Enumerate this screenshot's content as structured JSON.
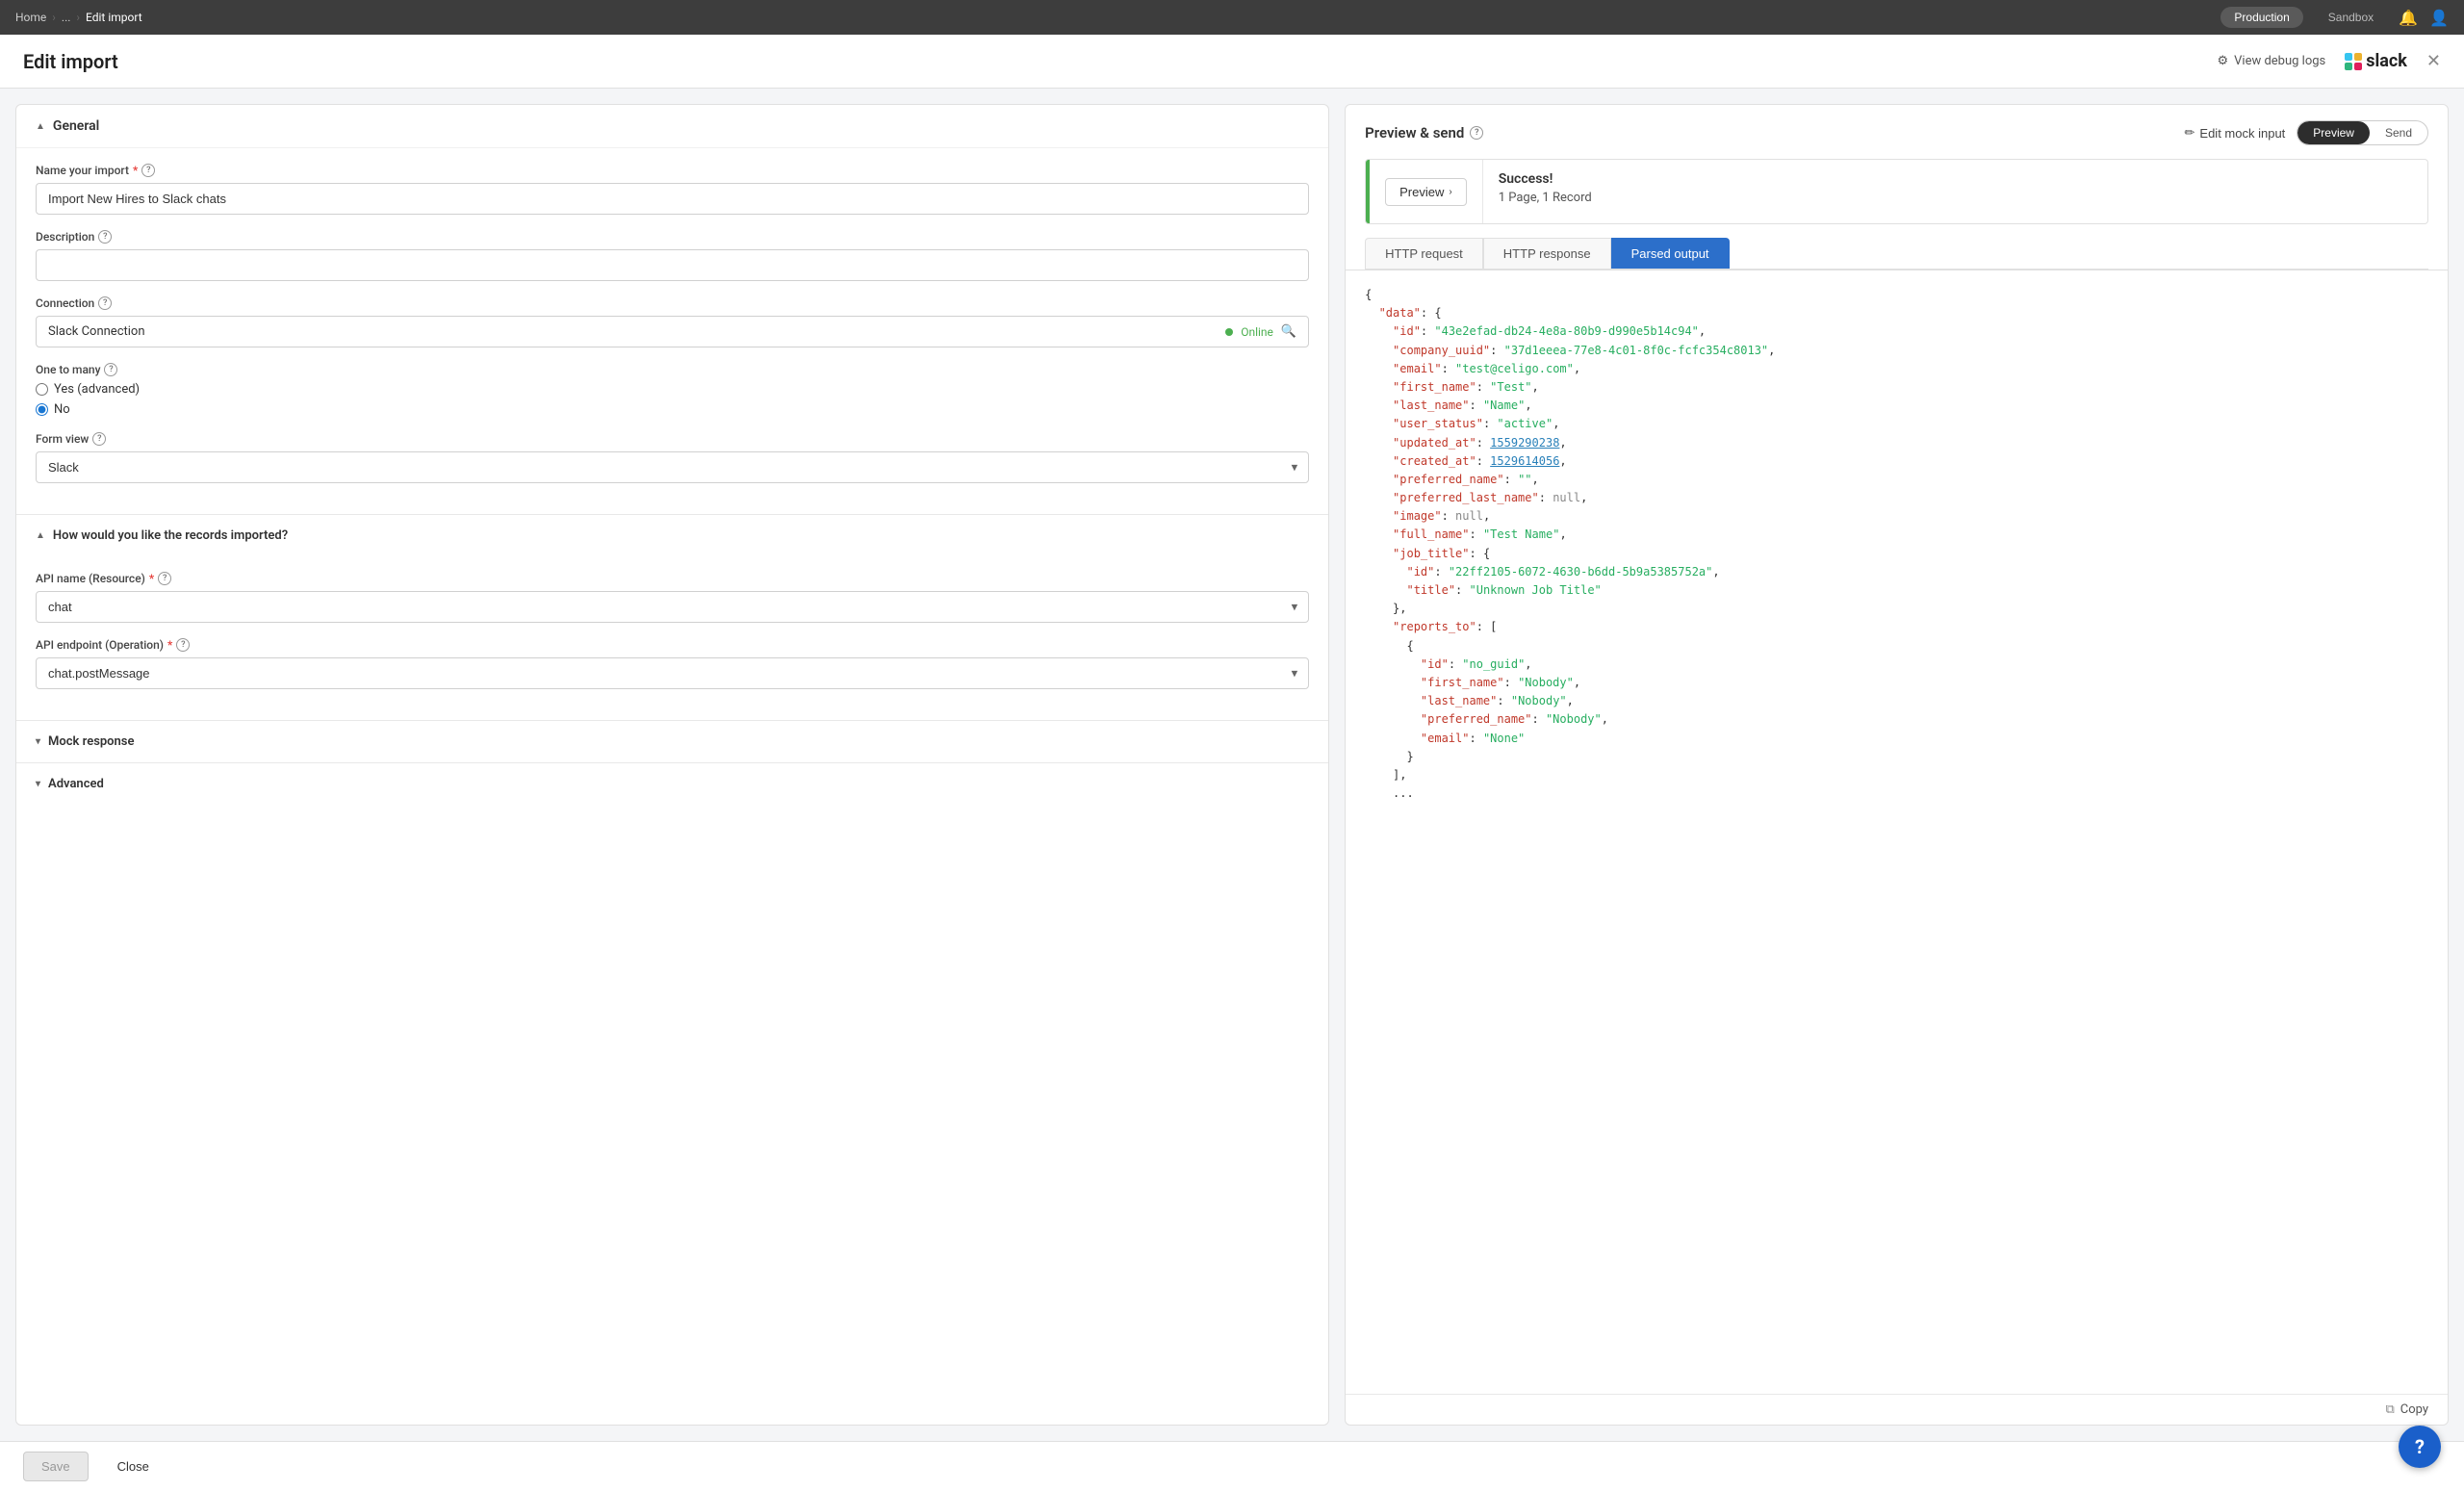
{
  "topNav": {
    "breadcrumbs": [
      "Home",
      "...",
      "Edit import"
    ],
    "environments": [
      {
        "label": "Production",
        "active": true
      },
      {
        "label": "Sandbox",
        "active": false
      }
    ]
  },
  "pageHeader": {
    "title": "Edit import",
    "debugLogsLabel": "View debug logs",
    "slackLabel": "slack"
  },
  "general": {
    "sectionLabel": "General",
    "nameLabel": "Name your import",
    "nameValue": "Import New Hires to Slack chats",
    "namePlaceholder": "Import New Hires to Slack chats",
    "descriptionLabel": "Description",
    "descriptionPlaceholder": "",
    "connectionLabel": "Connection",
    "connectionValue": "Slack Connection",
    "connectionStatus": "Online",
    "oneToManyLabel": "One to many",
    "oneToManyOptions": [
      {
        "label": "Yes (advanced)",
        "value": "yes"
      },
      {
        "label": "No",
        "value": "no"
      }
    ],
    "formViewLabel": "Form view",
    "formViewValue": "Slack"
  },
  "import": {
    "sectionLabel": "How would you like the records imported?",
    "apiNameLabel": "API name (Resource)",
    "apiNameValue": "chat",
    "apiEndpointLabel": "API endpoint (Operation)",
    "apiEndpointValue": "chat.postMessage"
  },
  "mockResponse": {
    "sectionLabel": "Mock response"
  },
  "advanced": {
    "sectionLabel": "Advanced"
  },
  "previewSend": {
    "title": "Preview & send",
    "editMockLabel": "Edit mock input",
    "previewLabel": "Preview",
    "sendLabel": "Send",
    "previewBtnLabel": "Preview",
    "successText": "Success!",
    "recordsText": "1 Page, 1 Record",
    "tabs": [
      {
        "label": "HTTP request",
        "active": false
      },
      {
        "label": "HTTP response",
        "active": false
      },
      {
        "label": "Parsed output",
        "active": true
      }
    ],
    "jsonLines": [
      {
        "text": "{",
        "type": "brace"
      },
      {
        "text": "  \"data\": {",
        "type": "key"
      },
      {
        "text": "    \"id\": \"43e2efad-db24-4e8a-80b9-d990e5b14c94\",",
        "type": "string-val",
        "key": "id",
        "val": "43e2efad-db24-4e8a-80b9-d990e5b14c94"
      },
      {
        "text": "    \"company_uuid\": \"37d1eeea-77e8-4c01-8f0c-fcfc354c8013\",",
        "type": "string-val",
        "key": "company_uuid",
        "val": "37d1eeea-77e8-4c01-8f0c-fcfc354c8013"
      },
      {
        "text": "    \"email\": \"test@celigo.com\",",
        "type": "string-val",
        "key": "email",
        "val": "test@celigo.com"
      },
      {
        "text": "    \"first_name\": \"Test\",",
        "type": "string-val",
        "key": "first_name",
        "val": "Test"
      },
      {
        "text": "    \"last_name\": \"Name\",",
        "type": "string-val",
        "key": "last_name",
        "val": "Name"
      },
      {
        "text": "    \"user_status\": \"active\",",
        "type": "string-val",
        "key": "user_status",
        "val": "active"
      },
      {
        "text": "    \"updated_at\": 1559290238,",
        "type": "number-val",
        "key": "updated_at",
        "val": "1559290238"
      },
      {
        "text": "    \"created_at\": 1529614056,",
        "type": "number-val",
        "key": "created_at",
        "val": "1529614056"
      },
      {
        "text": "    \"preferred_name\": \"\",",
        "type": "string-val",
        "key": "preferred_name",
        "val": ""
      },
      {
        "text": "    \"preferred_last_name\": null,",
        "type": "null-val",
        "key": "preferred_last_name"
      },
      {
        "text": "    \"image\": null,",
        "type": "null-val",
        "key": "image"
      },
      {
        "text": "    \"full_name\": \"Test Name\",",
        "type": "string-val",
        "key": "full_name",
        "val": "Test Name"
      },
      {
        "text": "    \"job_title\": {",
        "type": "key",
        "key": "job_title"
      },
      {
        "text": "      \"id\": \"22ff2105-6072-4630-b6dd-5b9a5385752a\",",
        "type": "string-val",
        "key": "id",
        "val": "22ff2105-6072-4630-b6dd-5b9a5385752a"
      },
      {
        "text": "      \"title\": \"Unknown Job Title\"",
        "type": "string-val",
        "key": "title",
        "val": "Unknown Job Title"
      },
      {
        "text": "    },",
        "type": "brace"
      },
      {
        "text": "    \"reports_to\": [",
        "type": "key",
        "key": "reports_to"
      },
      {
        "text": "      {",
        "type": "brace"
      },
      {
        "text": "        \"id\": \"no_guid\",",
        "type": "string-val",
        "key": "id",
        "val": "no_guid"
      },
      {
        "text": "        \"first_name\": \"Nobody\",",
        "type": "string-val",
        "key": "first_name",
        "val": "Nobody"
      },
      {
        "text": "        \"last_name\": \"Nobody\",",
        "type": "string-val",
        "key": "last_name",
        "val": "Nobody"
      },
      {
        "text": "        \"preferred_name\": \"Nobody\",",
        "type": "string-val",
        "key": "preferred_name",
        "val": "Nobody"
      },
      {
        "text": "        \"email\": \"None\"",
        "type": "string-val",
        "key": "email",
        "val": "None"
      },
      {
        "text": "      }",
        "type": "brace"
      },
      {
        "text": "    ],",
        "type": "brace"
      },
      {
        "text": "    ...",
        "type": "brace"
      }
    ],
    "copyLabel": "Copy"
  },
  "footer": {
    "saveLabel": "Save",
    "closeLabel": "Close"
  },
  "helpBubble": "?"
}
